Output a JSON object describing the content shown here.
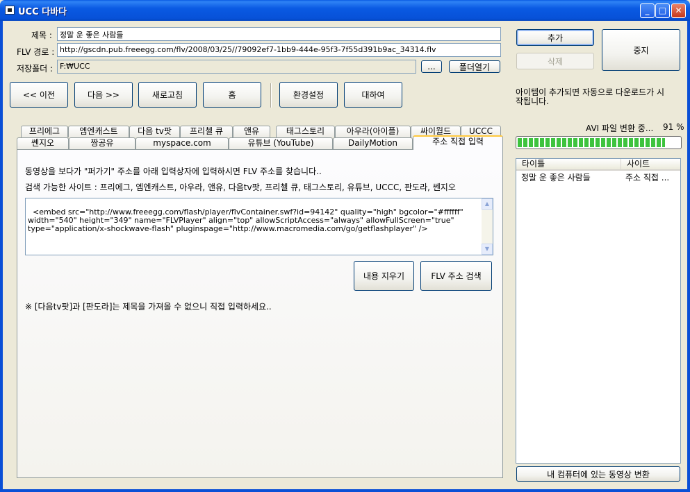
{
  "window": {
    "title": "UCC 다바다",
    "minimize_glyph": "_",
    "maximize_glyph": "□",
    "close_glyph": "✕"
  },
  "fields": {
    "title_label": "제목 :",
    "title_value": "정말 운 좋은 사람들",
    "flv_label": "FLV 경로 :",
    "flv_value": "http://gscdn.pub.freeegg.com/flv/2008/03/25//79092ef7-1bb9-444e-95f3-7f55d391b9ac_34314.flv",
    "folder_label": "저장폴더 :",
    "folder_value": "F:₩UCC",
    "browse_label": "...",
    "open_folder_label": "폴더열기"
  },
  "actions": {
    "add_label": "추가",
    "delete_label": "삭제",
    "stop_label": "중지"
  },
  "nav": {
    "prev_label": "<< 이전",
    "next_label": "다음 >>",
    "refresh_label": "새로고침",
    "home_label": "홈",
    "settings_label": "환경설정",
    "about_label": "대하여"
  },
  "info_text": "아이템이 추가되면 자동으로 다운로드가 시작됩니다.",
  "info_line1": "아이템이 추가되면 자동으로 다운로드가 시",
  "info_line2": "작됩니다.",
  "status": {
    "converting_text": "AVI 파일 변환 중...",
    "percent_text": "91 %",
    "progress_fraction": 0.91,
    "bar_color": "#3ec33e"
  },
  "tabs": {
    "row1": [
      "프리에그",
      "엠엔캐스트",
      "다음 tv팟",
      "프리첼 큐",
      "앤유",
      "태그스토리",
      "아우라(아이플)",
      "싸이월드",
      "UCCC"
    ],
    "row2": [
      "쎈지오",
      "짱공유",
      "myspace.com",
      "유튜브 (YouTube)",
      "DailyMotion",
      "주소 직접 입력"
    ],
    "active": "주소 직접 입력"
  },
  "panel": {
    "instruction": "동영상을 보다가 \"퍼가기\" 주소를 아래 입력상자에 입력하시면 FLV 주소를 찾습니다..",
    "sites": "검색 가능한 사이트 : 프리에그, 엠엔캐스트, 아우라, 앤유, 다음tv팟, 프리첼 큐, 태그스토리, 유튜브, UCCC, 판도라, 쎈지오",
    "embed_code": "<embed src=\"http://www.freeegg.com/flash/player/flvContainer.swf?id=94142\" quality=\"high\" bgcolor=\"#ffffff\"\nwidth=\"540\" height=\"349\" name=\"FLVPlayer\" align=\"top\" allowScriptAccess=\"always\" allowFullScreen=\"true\"\ntype=\"application/x-shockwave-flash\" pluginspage=\"http://www.macromedia.com/go/getflashplayer\" />",
    "clear_label": "내용 지우기",
    "search_label": "FLV 주소 검색",
    "note": "※ [다음tv팟]과 [판도라]는 제목을 가져올 수 없으니 직접 입력하세요.."
  },
  "listview": {
    "columns": [
      "타이틀",
      "사이트"
    ],
    "rows": [
      {
        "title": "정말 운 좋은 사람들",
        "site": "주소 직접 ..."
      }
    ]
  },
  "convert_label": "내 컴퓨터에 있는 동영상 변환",
  "colors": {
    "titlebar": "#0a5ae3",
    "window_bg": "#ece9d8",
    "active_tab_accent": "#ffc83c"
  }
}
